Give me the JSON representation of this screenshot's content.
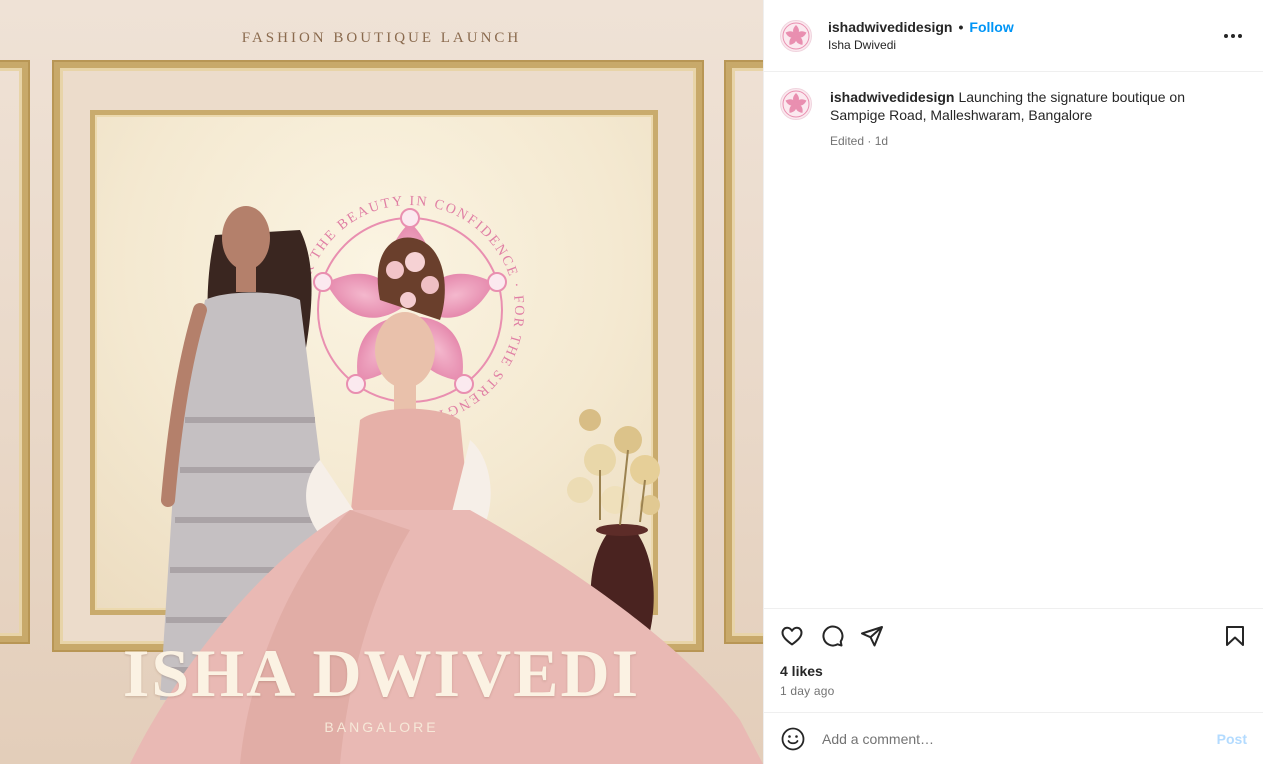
{
  "media": {
    "top_text": "FASHION BOUTIQUE LAUNCH",
    "brand_name": "ISHA DWIVEDI",
    "brand_city": "BANGALORE",
    "logo_ring_text": "FOR THE BEAUTY IN CONFIDENCE · FOR THE STRENGTH IN",
    "colors": {
      "logo_pink": "#e98fb0",
      "frame_gold": "#c8a96a",
      "dress_pink": "#e8b6b0"
    }
  },
  "header": {
    "username": "ishadwivedidesign",
    "separator": "•",
    "follow_label": "Follow",
    "subtitle": "Isha Dwivedi",
    "more_icon": "more-horizontal-icon"
  },
  "caption": {
    "username": "ishadwivedidesign",
    "text": "Launching the signature boutique on Sampige Road, Malleshwaram, Bangalore",
    "meta": "Edited · 1d"
  },
  "actions": {
    "icons": [
      "heart-icon",
      "comment-icon",
      "share-icon",
      "bookmark-icon"
    ],
    "likes": "4 likes",
    "time_ago": "1 day ago"
  },
  "comment": {
    "emoji_icon": "emoji-icon",
    "placeholder": "Add a comment…",
    "post_label": "Post"
  },
  "colors": {
    "accent": "#0095f6",
    "post_disabled": "#b3dbff",
    "text": "#262626",
    "muted": "#737373"
  }
}
